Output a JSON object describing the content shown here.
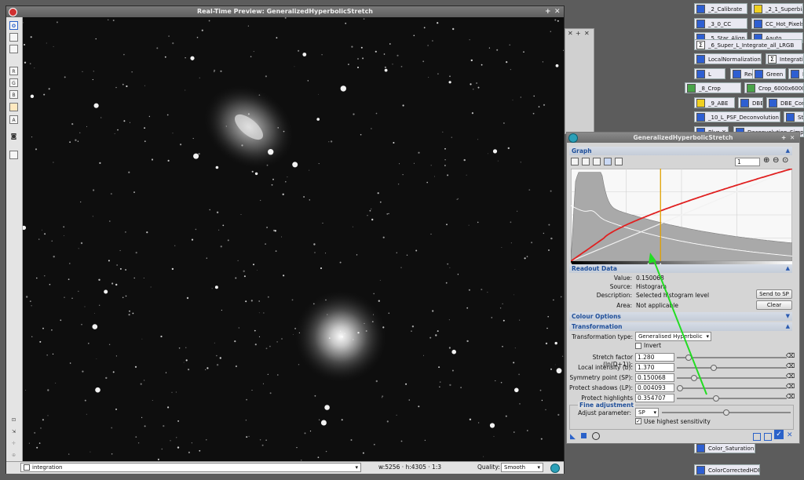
{
  "preview": {
    "title": "Real-Time Preview: GeneralizedHyperbolicStretch",
    "view": "integration",
    "dims": "w:5256 · h:4305 · 1:3",
    "quality_label": "Quality:",
    "quality_value": "Smooth"
  },
  "left_tools": [
    "O",
    "",
    "",
    "R",
    "G",
    "B",
    "",
    "A"
  ],
  "workspace": {
    "icons": [
      {
        "label": "_2_Calibrate",
        "kind": "b"
      },
      {
        "label": "_2_1_Superbias",
        "kind": "y"
      },
      {
        "label": "_3_0_CC",
        "kind": "b"
      },
      {
        "label": "CC_Hot_Pixels",
        "kind": "b"
      },
      {
        "label": "_5_Star_Align",
        "kind": "b"
      },
      {
        "label": "Aauto",
        "kind": "b"
      },
      {
        "label": "_6_Super_L_Integrate_all_LRGB",
        "kind": "s"
      },
      {
        "label": "LocalNormalization",
        "kind": "b"
      },
      {
        "label": "Integration",
        "kind": "s"
      },
      {
        "label": "L",
        "kind": "b"
      },
      {
        "label": "Red",
        "kind": "b"
      },
      {
        "label": "Green",
        "kind": "b"
      },
      {
        "label": "B",
        "kind": "b"
      },
      {
        "label": "_8_Crop",
        "kind": "g"
      },
      {
        "label": "Crop_6000x6000",
        "kind": "g"
      },
      {
        "label": "_9_ABE",
        "kind": "y"
      },
      {
        "label": "DBE",
        "kind": "b"
      },
      {
        "label": "DBE_Corr",
        "kind": "b"
      },
      {
        "label": "_10_L_PSF_Deconvolution",
        "kind": "b"
      },
      {
        "label": "Star",
        "kind": "b"
      },
      {
        "label": "Blur_X",
        "kind": "b"
      },
      {
        "label": "Deconvolution_Simpl",
        "kind": "b"
      },
      {
        "label": "Color_Saturation",
        "kind": "b"
      },
      {
        "label": "ColorCorrectedHDRM",
        "kind": "b"
      }
    ]
  },
  "ghs": {
    "title": "GeneralizedHyperbolicStretch",
    "graph_section": "Graph",
    "zoom_value": "1",
    "readout_section": "Readout Data",
    "readout": {
      "value_label": "Value:",
      "value": "0.150068",
      "source_label": "Source:",
      "source": "Histogram",
      "description_label": "Description:",
      "description": "Selected histogram level",
      "area_label": "Area:",
      "area": "Not applicable",
      "send_button": "Send to SP",
      "clear_button": "Clear"
    },
    "colour_section": "Colour Options",
    "transform_section": "Transformation",
    "transformation_type_label": "Transformation type:",
    "transformation_type": "Generalised Hyperbolic",
    "invert_label": "Invert",
    "params": [
      {
        "label": "Stretch factor (ln(D+1)):",
        "value": "1.280",
        "pos": 0.1
      },
      {
        "label": "Local intensity (b):",
        "value": "1.370",
        "pos": 0.33
      },
      {
        "label": "Symmetry point (SP):",
        "value": "0.150068",
        "pos": 0.15
      },
      {
        "label": "Protect shadows (LP):",
        "value": "0.004093",
        "pos": 0.02
      },
      {
        "label": "Protect highlights (HP):",
        "value": "0.354707",
        "pos": 0.35
      }
    ],
    "fine_section": "Fine adjustment",
    "adjust_label": "Adjust parameter:",
    "adjust_value": "SP",
    "highest_sens_label": "Use highest sensitivity",
    "colors": {
      "curve": "#e02020",
      "identity": "#f2f2f2",
      "marker": "#e0a000",
      "annotation": "#22dd22"
    }
  }
}
